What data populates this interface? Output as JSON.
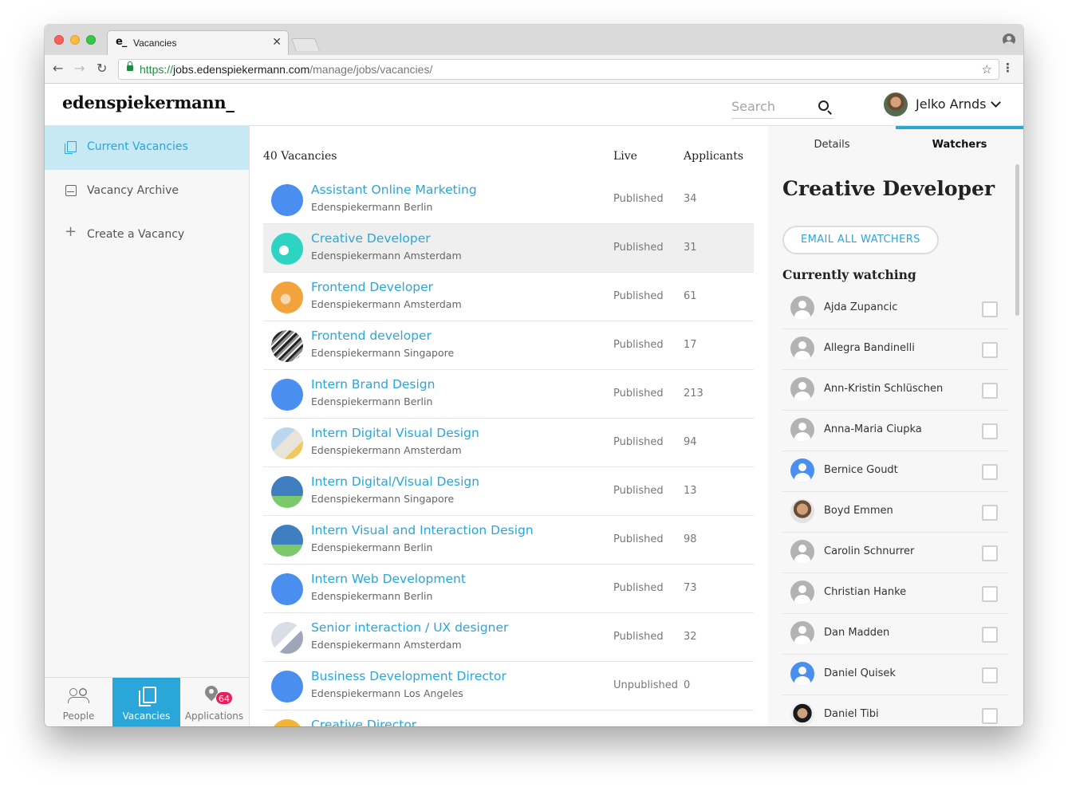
{
  "browser": {
    "tab_title": "Vacancies",
    "tab_favicon": "e_",
    "url_scheme": "https://",
    "url_host": "jobs.edenspiekermann.com",
    "url_path": "/manage/jobs/vacancies/"
  },
  "header": {
    "logo": "edenspiekermann_",
    "search_placeholder": "Search",
    "user_name": "Jelko Arnds"
  },
  "sidebar": {
    "items": [
      {
        "label": "Current Vacancies",
        "icon": "copy-icon",
        "active": true
      },
      {
        "label": "Vacancy Archive",
        "icon": "archive-icon",
        "active": false
      },
      {
        "label": "Create a Vacancy",
        "icon": "plus-icon",
        "active": false
      }
    ]
  },
  "bottom_nav": {
    "items": [
      {
        "label": "People",
        "icon": "people-icon"
      },
      {
        "label": "Vacancies",
        "icon": "vacancies-icon"
      },
      {
        "label": "Applications",
        "icon": "applications-icon",
        "badge": "64"
      }
    ]
  },
  "list": {
    "count_label": "40 Vacancies",
    "col_live": "Live",
    "col_applicants": "Applicants",
    "rows": [
      {
        "title": "Assistant Online Marketing",
        "office": "Edenspiekermann Berlin",
        "status": "Published",
        "applicants": "34"
      },
      {
        "title": "Creative Developer",
        "office": "Edenspiekermann Amsterdam",
        "status": "Published",
        "applicants": "31"
      },
      {
        "title": "Frontend Developer",
        "office": "Edenspiekermann Amsterdam",
        "status": "Published",
        "applicants": "61"
      },
      {
        "title": "Frontend developer",
        "office": "Edenspiekermann Singapore",
        "status": "Published",
        "applicants": "17"
      },
      {
        "title": "Intern Brand Design",
        "office": "Edenspiekermann Berlin",
        "status": "Published",
        "applicants": "213"
      },
      {
        "title": "Intern Digital Visual Design",
        "office": "Edenspiekermann Amsterdam",
        "status": "Published",
        "applicants": "94"
      },
      {
        "title": "Intern Digital/Visual Design",
        "office": "Edenspiekermann Singapore",
        "status": "Published",
        "applicants": "13"
      },
      {
        "title": "Intern Visual and Interaction Design",
        "office": "Edenspiekermann Berlin",
        "status": "Published",
        "applicants": "98"
      },
      {
        "title": "Intern Web Development",
        "office": "Edenspiekermann Berlin",
        "status": "Published",
        "applicants": "73"
      },
      {
        "title": "Senior interaction / UX designer",
        "office": "Edenspiekermann Amsterdam",
        "status": "Published",
        "applicants": "32"
      },
      {
        "title": "Business Development Director",
        "office": "Edenspiekermann Los Angeles",
        "status": "Unpublished",
        "applicants": "0"
      },
      {
        "title": "Creative Director",
        "office": "",
        "status": "",
        "applicants": ""
      }
    ]
  },
  "panel": {
    "tabs": [
      "Details",
      "Watchers"
    ],
    "title": "Creative Developer",
    "email_button": "EMAIL ALL WATCHERS",
    "watching_heading": "Currently watching",
    "watchers": [
      "Ajda Zupancic",
      "Allegra Bandinelli",
      "Ann-Kristin Schlüschen",
      "Anna-Maria Ciupka",
      "Bernice Goudt",
      "Boyd Emmen",
      "Carolin Schnurrer",
      "Christian Hanke",
      "Dan Madden",
      "Daniel Quisek",
      "Daniel Tibi"
    ]
  },
  "colors": {
    "accent": "#2aa6d8",
    "active_sidebar_bg": "#c7e9f5",
    "badge": "#e6205a"
  }
}
